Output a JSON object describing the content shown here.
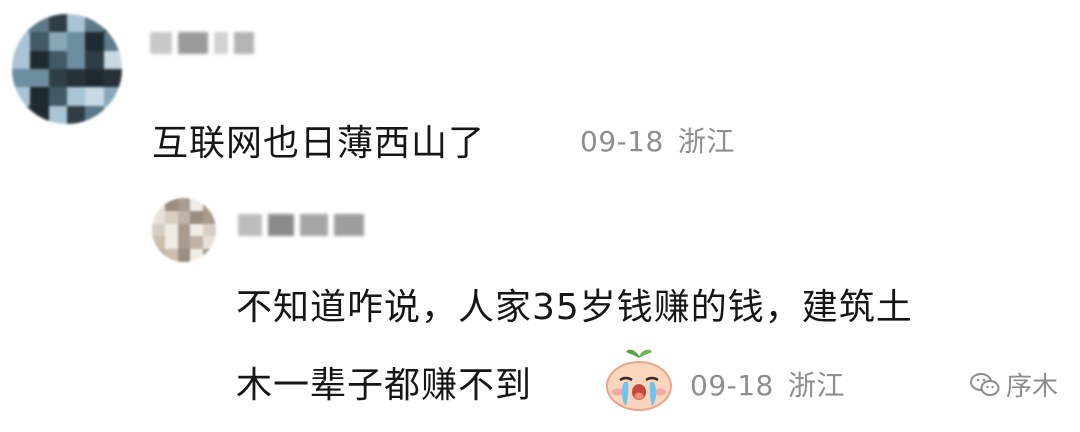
{
  "comment": {
    "text": "互联网也日薄西山了",
    "date": "09-18",
    "location": "浙江"
  },
  "reply": {
    "text_line1": "不知道咋说，人家35岁钱赚的钱，建筑土",
    "text_line2": "木一辈子都赚不到",
    "emoji": "crying-emoji",
    "date": "09-18",
    "location": "浙江"
  },
  "watermark": {
    "icon": "wechat-icon",
    "label": "序木"
  }
}
